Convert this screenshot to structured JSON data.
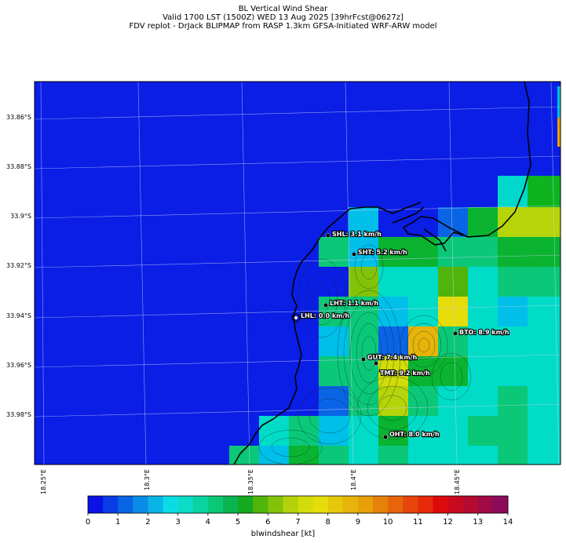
{
  "header": {
    "line1": "BL Vertical Wind Shear",
    "line2": "Valid 1700 LST (1500Z) WED 13 Aug 2025 [39hrFcst@0627z]",
    "line3": "FDV replot - DrJack BLIPMAP from RASP 1.3km GFSA-Initiated WRF-ARW model"
  },
  "map": {
    "lat_labels": [
      "33.86°S",
      "33.88°S",
      "33.9°S",
      "33.92°S",
      "33.94°S",
      "33.96°S",
      "33.98°S"
    ],
    "lon_labels": [
      "18.25°E",
      "18.3°E",
      "18.35°E",
      "18.4°E",
      "18.45°E"
    ],
    "background_color": "#0a1ee6",
    "stations": [
      {
        "label": "SHL: 3.1 km/h"
      },
      {
        "label": "SHT: 5.2 km/h"
      },
      {
        "label": "LHT: 1.1 km/h"
      },
      {
        "label": "LHL: 0.0 km/h"
      },
      {
        "label": "BTO: 8.9 km/h"
      },
      {
        "label": "GUT: 7.4 km/h"
      },
      {
        "label": "TMT: 9.2 km/h"
      },
      {
        "label": "OHT: 8.0 km/h"
      }
    ]
  },
  "colorbar": {
    "ticks": [
      "0",
      "1",
      "2",
      "3",
      "4",
      "5",
      "6",
      "7",
      "8",
      "9",
      "10",
      "11",
      "12",
      "13",
      "14"
    ],
    "label": "blwindshear [kt]",
    "colors": [
      "#0a12e6",
      "#0a3ce6",
      "#0a64e6",
      "#0a8ce6",
      "#0ab4e6",
      "#0adce6",
      "#0adcc8",
      "#0ad2a0",
      "#0ac878",
      "#0ab450",
      "#14aa1e",
      "#50b40a",
      "#82c30a",
      "#b4d20a",
      "#d2dc0a",
      "#e6dc0a",
      "#e6c80a",
      "#e6b40a",
      "#e6a00a",
      "#e6820a",
      "#e6640a",
      "#e6460a",
      "#e62a0a",
      "#dc0a0a",
      "#c80a1e",
      "#b40a32",
      "#a00a46",
      "#8c0a5a"
    ]
  }
}
